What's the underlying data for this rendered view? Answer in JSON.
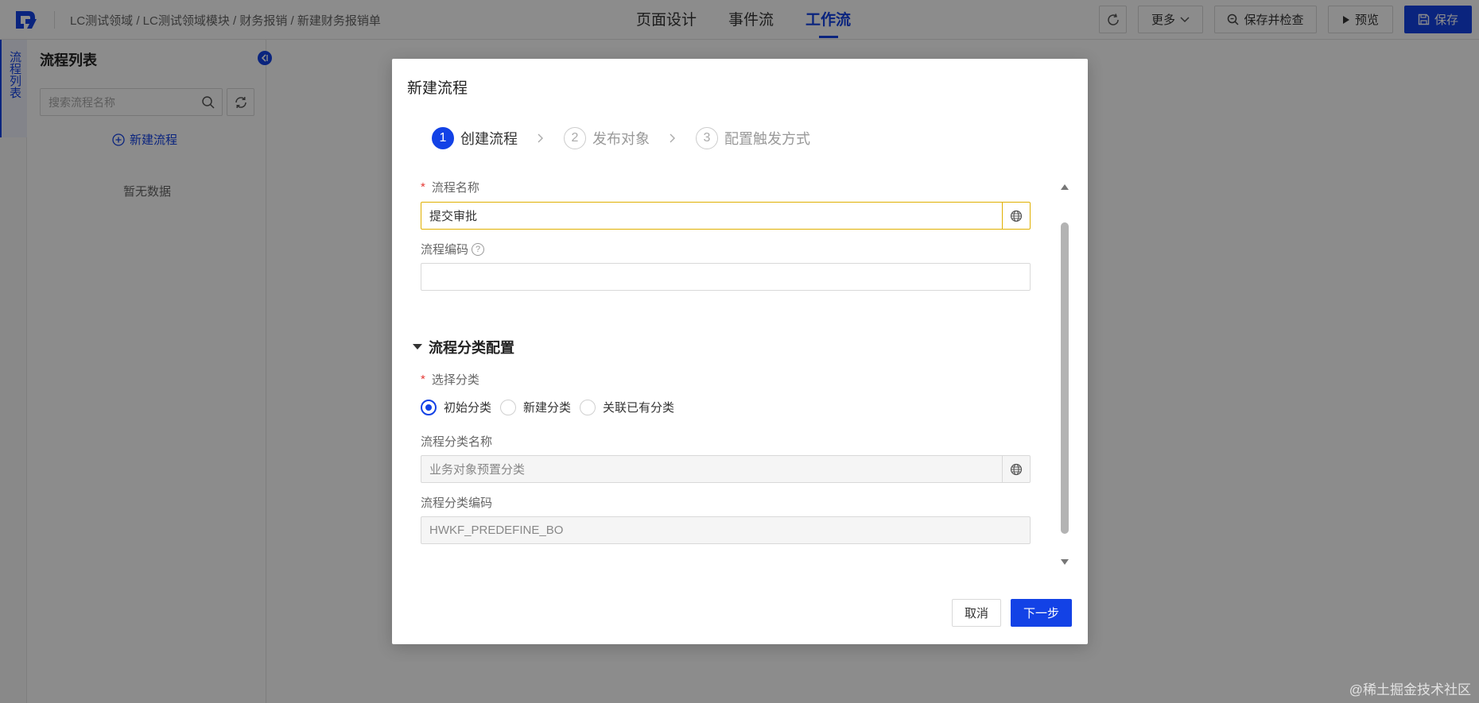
{
  "header": {
    "breadcrumb": "LC测试领域 / LC测试领域模块 / 财务报销 / 新建财务报销单",
    "tabs": [
      {
        "label": "页面设计",
        "active": false
      },
      {
        "label": "事件流",
        "active": false
      },
      {
        "label": "工作流",
        "active": true
      }
    ],
    "more_label": "更多",
    "save_check_label": "保存并检查",
    "preview_label": "预览",
    "save_label": "保存"
  },
  "rail": {
    "tab_label": "流程列表"
  },
  "panel": {
    "title": "流程列表",
    "search_placeholder": "搜索流程名称",
    "new_flow_label": "新建流程",
    "empty_text": "暂无数据"
  },
  "modal": {
    "title": "新建流程",
    "steps": [
      {
        "num": "1",
        "label": "创建流程",
        "active": true
      },
      {
        "num": "2",
        "label": "发布对象",
        "active": false
      },
      {
        "num": "3",
        "label": "配置触发方式",
        "active": false
      }
    ],
    "flow_name": {
      "label": "流程名称",
      "required_mark": "*",
      "value": "提交审批"
    },
    "flow_code": {
      "label": "流程编码",
      "value": ""
    },
    "section_title": "流程分类配置",
    "category": {
      "label": "选择分类",
      "required_mark": "*",
      "options": [
        {
          "label": "初始分类",
          "checked": true
        },
        {
          "label": "新建分类",
          "checked": false
        },
        {
          "label": "关联已有分类",
          "checked": false
        }
      ]
    },
    "category_name": {
      "label": "流程分类名称",
      "value": "业务对象预置分类"
    },
    "category_code": {
      "label": "流程分类编码",
      "value": "HWKF_PREDEFINE_BO"
    },
    "cancel_label": "取消",
    "next_label": "下一步"
  },
  "watermark": "@稀土掘金技术社区",
  "colors": {
    "primary": "#1342e6",
    "required": "#e53935",
    "focus_border": "#e0b000"
  }
}
